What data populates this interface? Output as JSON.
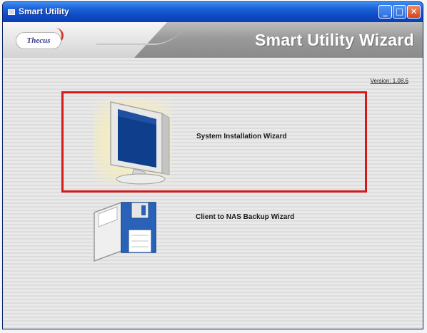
{
  "window": {
    "title": "Smart Utility",
    "minimize": "_",
    "maximize": "□",
    "close": "✕"
  },
  "header": {
    "logo": "Thecus",
    "title": "Smart Utility Wizard"
  },
  "version": "Version: 1.08.6",
  "options": [
    {
      "label": "System Installation Wizard",
      "icon": "monitor-icon",
      "selected": true
    },
    {
      "label": "Client to NAS Backup Wizard",
      "icon": "floppy-disk-icon",
      "selected": false
    }
  ],
  "colors": {
    "titlebar": "#0e49c4",
    "selection_border": "#d41a1a",
    "floppy_blue": "#2a62b8",
    "screen_blue": "#0f3f8c"
  }
}
